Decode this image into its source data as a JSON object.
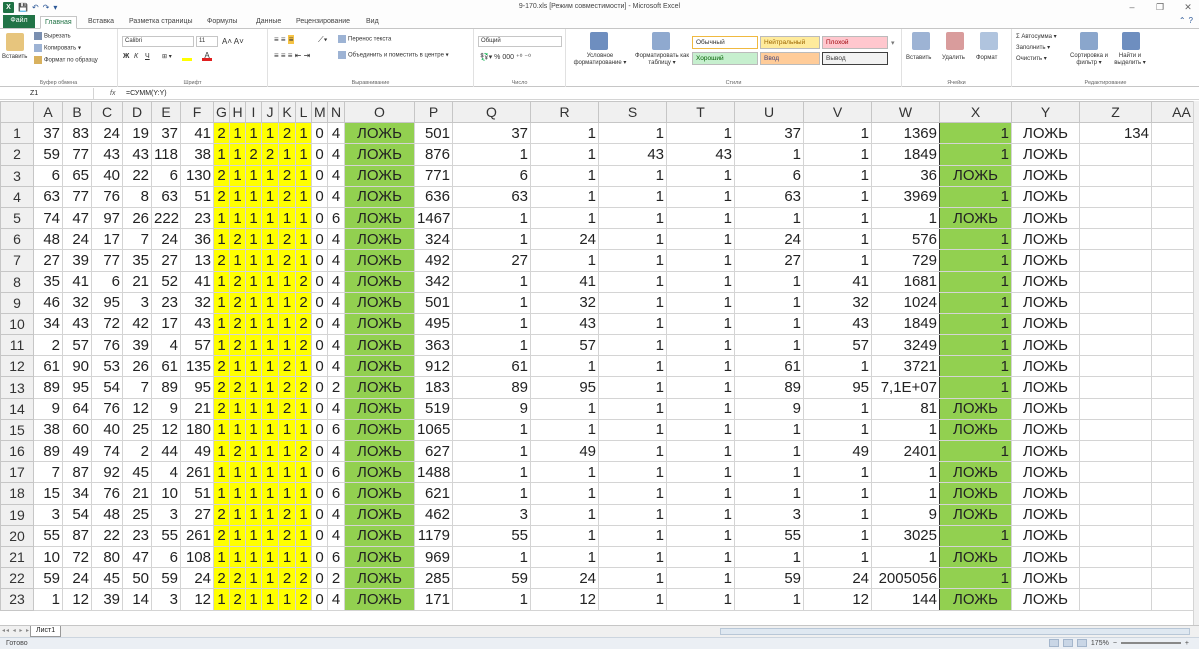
{
  "window": {
    "title": "9-170.xls  [Режим совместимости]  -  Microsoft Excel",
    "minimize": "–",
    "restore": "❐",
    "close": "✕"
  },
  "qat": {
    "save": "💾",
    "undo": "↶",
    "redo": "↷",
    "customize": "▾"
  },
  "tabs": {
    "file": "Файл",
    "home": "Главная",
    "insert": "Вставка",
    "layout": "Разметка страницы",
    "formulas": "Формулы",
    "data": "Данные",
    "review": "Рецензирование",
    "view": "Вид"
  },
  "ribbon": {
    "clipboard": {
      "paste": "Вставить",
      "cut": "Вырезать",
      "copy": "Копировать ▾",
      "format_painter": "Формат по образцу",
      "label": "Буфер обмена"
    },
    "font": {
      "name": "Calibri",
      "size": "11",
      "bold": "Ж",
      "italic": "К",
      "underline": "Ч",
      "label": "Шрифт"
    },
    "alignment": {
      "wrap": "Перенос текста",
      "merge": "Объединить и поместить в центре ▾",
      "label": "Выравнивание"
    },
    "number": {
      "format": "Общий",
      "label": "Число"
    },
    "styles": {
      "conditional": "Условное форматирование ▾",
      "as_table": "Форматировать как таблицу ▾",
      "normal": "Обычный",
      "neutral": "Нейтральный",
      "bad": "Плохой",
      "good": "Хороший",
      "input": "Ввод",
      "output": "Вывод",
      "label": "Стили"
    },
    "cells": {
      "insert": "Вставить",
      "delete": "Удалить",
      "format": "Формат",
      "label": "Ячейки"
    },
    "editing": {
      "autosum": "Σ Автосумма ▾",
      "fill": "Заполнить ▾",
      "clear": "Очистить ▾",
      "sort": "Сортировка и фильтр ▾",
      "find": "Найти и выделить ▾",
      "label": "Редактирование"
    }
  },
  "formula_bar": {
    "name_box": "Z1",
    "fx": "fx",
    "formula": "=СУММ(Y:Y)"
  },
  "columns": [
    "A",
    "B",
    "C",
    "D",
    "E",
    "F",
    "G",
    "H",
    "I",
    "J",
    "K",
    "L",
    "M",
    "N",
    "O",
    "P",
    "Q",
    "R",
    "S",
    "T",
    "U",
    "V",
    "W",
    "X",
    "Y",
    "Z",
    "AA"
  ],
  "rows": [
    [
      "37",
      "83",
      "24",
      "19",
      "37",
      "41",
      "2",
      "1",
      "1",
      "1",
      "2",
      "1",
      "0",
      "4",
      "ЛОЖЬ",
      "501",
      "37",
      "1",
      "1",
      "1",
      "37",
      "1",
      "1369",
      "1",
      "ЛОЖЬ",
      "134"
    ],
    [
      "59",
      "77",
      "43",
      "43",
      "118",
      "38",
      "1",
      "1",
      "2",
      "2",
      "1",
      "1",
      "0",
      "4",
      "ЛОЖЬ",
      "876",
      "1",
      "1",
      "43",
      "43",
      "1",
      "1",
      "1849",
      "1",
      "ЛОЖЬ",
      ""
    ],
    [
      "6",
      "65",
      "40",
      "22",
      "6",
      "130",
      "2",
      "1",
      "1",
      "1",
      "2",
      "1",
      "0",
      "4",
      "ЛОЖЬ",
      "771",
      "6",
      "1",
      "1",
      "1",
      "6",
      "1",
      "36",
      "ЛОЖЬ",
      "ЛОЖЬ",
      ""
    ],
    [
      "63",
      "77",
      "76",
      "8",
      "63",
      "51",
      "2",
      "1",
      "1",
      "1",
      "2",
      "1",
      "0",
      "4",
      "ЛОЖЬ",
      "636",
      "63",
      "1",
      "1",
      "1",
      "63",
      "1",
      "3969",
      "1",
      "ЛОЖЬ",
      ""
    ],
    [
      "74",
      "47",
      "97",
      "26",
      "222",
      "23",
      "1",
      "1",
      "1",
      "1",
      "1",
      "1",
      "0",
      "6",
      "ЛОЖЬ",
      "1467",
      "1",
      "1",
      "1",
      "1",
      "1",
      "1",
      "1",
      "ЛОЖЬ",
      "ЛОЖЬ",
      ""
    ],
    [
      "48",
      "24",
      "17",
      "7",
      "24",
      "36",
      "1",
      "2",
      "1",
      "1",
      "2",
      "1",
      "0",
      "4",
      "ЛОЖЬ",
      "324",
      "1",
      "24",
      "1",
      "1",
      "24",
      "1",
      "576",
      "1",
      "ЛОЖЬ",
      ""
    ],
    [
      "27",
      "39",
      "77",
      "35",
      "27",
      "13",
      "2",
      "1",
      "1",
      "1",
      "2",
      "1",
      "0",
      "4",
      "ЛОЖЬ",
      "492",
      "27",
      "1",
      "1",
      "1",
      "27",
      "1",
      "729",
      "1",
      "ЛОЖЬ",
      ""
    ],
    [
      "35",
      "41",
      "6",
      "21",
      "52",
      "41",
      "1",
      "2",
      "1",
      "1",
      "1",
      "2",
      "0",
      "4",
      "ЛОЖЬ",
      "342",
      "1",
      "41",
      "1",
      "1",
      "1",
      "41",
      "1681",
      "1",
      "ЛОЖЬ",
      ""
    ],
    [
      "46",
      "32",
      "95",
      "3",
      "23",
      "32",
      "1",
      "2",
      "1",
      "1",
      "1",
      "2",
      "0",
      "4",
      "ЛОЖЬ",
      "501",
      "1",
      "32",
      "1",
      "1",
      "1",
      "32",
      "1024",
      "1",
      "ЛОЖЬ",
      ""
    ],
    [
      "34",
      "43",
      "72",
      "42",
      "17",
      "43",
      "1",
      "2",
      "1",
      "1",
      "1",
      "2",
      "0",
      "4",
      "ЛОЖЬ",
      "495",
      "1",
      "43",
      "1",
      "1",
      "1",
      "43",
      "1849",
      "1",
      "ЛОЖЬ",
      ""
    ],
    [
      "2",
      "57",
      "76",
      "39",
      "4",
      "57",
      "1",
      "2",
      "1",
      "1",
      "1",
      "2",
      "0",
      "4",
      "ЛОЖЬ",
      "363",
      "1",
      "57",
      "1",
      "1",
      "1",
      "57",
      "3249",
      "1",
      "ЛОЖЬ",
      ""
    ],
    [
      "61",
      "90",
      "53",
      "26",
      "61",
      "135",
      "2",
      "1",
      "1",
      "1",
      "2",
      "1",
      "0",
      "4",
      "ЛОЖЬ",
      "912",
      "61",
      "1",
      "1",
      "1",
      "61",
      "1",
      "3721",
      "1",
      "ЛОЖЬ",
      ""
    ],
    [
      "89",
      "95",
      "54",
      "7",
      "89",
      "95",
      "2",
      "2",
      "1",
      "1",
      "2",
      "2",
      "0",
      "2",
      "ЛОЖЬ",
      "183",
      "89",
      "95",
      "1",
      "1",
      "89",
      "95",
      "7,1E+07",
      "1",
      "ЛОЖЬ",
      ""
    ],
    [
      "9",
      "64",
      "76",
      "12",
      "9",
      "21",
      "2",
      "1",
      "1",
      "1",
      "2",
      "1",
      "0",
      "4",
      "ЛОЖЬ",
      "519",
      "9",
      "1",
      "1",
      "1",
      "9",
      "1",
      "81",
      "ЛОЖЬ",
      "ЛОЖЬ",
      ""
    ],
    [
      "38",
      "60",
      "40",
      "25",
      "12",
      "180",
      "1",
      "1",
      "1",
      "1",
      "1",
      "1",
      "0",
      "6",
      "ЛОЖЬ",
      "1065",
      "1",
      "1",
      "1",
      "1",
      "1",
      "1",
      "1",
      "ЛОЖЬ",
      "ЛОЖЬ",
      ""
    ],
    [
      "89",
      "49",
      "74",
      "2",
      "44",
      "49",
      "1",
      "2",
      "1",
      "1",
      "1",
      "2",
      "0",
      "4",
      "ЛОЖЬ",
      "627",
      "1",
      "49",
      "1",
      "1",
      "1",
      "49",
      "2401",
      "1",
      "ЛОЖЬ",
      ""
    ],
    [
      "7",
      "87",
      "92",
      "45",
      "4",
      "261",
      "1",
      "1",
      "1",
      "1",
      "1",
      "1",
      "0",
      "6",
      "ЛОЖЬ",
      "1488",
      "1",
      "1",
      "1",
      "1",
      "1",
      "1",
      "1",
      "ЛОЖЬ",
      "ЛОЖЬ",
      ""
    ],
    [
      "15",
      "34",
      "76",
      "21",
      "10",
      "51",
      "1",
      "1",
      "1",
      "1",
      "1",
      "1",
      "0",
      "6",
      "ЛОЖЬ",
      "621",
      "1",
      "1",
      "1",
      "1",
      "1",
      "1",
      "1",
      "ЛОЖЬ",
      "ЛОЖЬ",
      ""
    ],
    [
      "3",
      "54",
      "48",
      "25",
      "3",
      "27",
      "2",
      "1",
      "1",
      "1",
      "2",
      "1",
      "0",
      "4",
      "ЛОЖЬ",
      "462",
      "3",
      "1",
      "1",
      "1",
      "3",
      "1",
      "9",
      "ЛОЖЬ",
      "ЛОЖЬ",
      ""
    ],
    [
      "55",
      "87",
      "22",
      "23",
      "55",
      "261",
      "2",
      "1",
      "1",
      "1",
      "2",
      "1",
      "0",
      "4",
      "ЛОЖЬ",
      "1179",
      "55",
      "1",
      "1",
      "1",
      "55",
      "1",
      "3025",
      "1",
      "ЛОЖЬ",
      ""
    ],
    [
      "10",
      "72",
      "80",
      "47",
      "6",
      "108",
      "1",
      "1",
      "1",
      "1",
      "1",
      "1",
      "0",
      "6",
      "ЛОЖЬ",
      "969",
      "1",
      "1",
      "1",
      "1",
      "1",
      "1",
      "1",
      "ЛОЖЬ",
      "ЛОЖЬ",
      ""
    ],
    [
      "59",
      "24",
      "45",
      "50",
      "59",
      "24",
      "2",
      "2",
      "1",
      "1",
      "2",
      "2",
      "0",
      "2",
      "ЛОЖЬ",
      "285",
      "59",
      "24",
      "1",
      "1",
      "59",
      "24",
      "2005056",
      "1",
      "ЛОЖЬ",
      ""
    ],
    [
      "1",
      "12",
      "39",
      "14",
      "3",
      "12",
      "1",
      "2",
      "1",
      "1",
      "1",
      "2",
      "0",
      "4",
      "ЛОЖЬ",
      "171",
      "1",
      "12",
      "1",
      "1",
      "1",
      "12",
      "144",
      "ЛОЖЬ",
      "ЛОЖЬ",
      ""
    ]
  ],
  "sheet_tabs": {
    "nav": "◂◂ ◂ ▸ ▸▸",
    "active": "Лист1"
  },
  "status": {
    "ready": "Готово",
    "zoom": "175%",
    "zoom_minus": "−",
    "zoom_plus": "+"
  },
  "colors": {
    "yellow": "#ffff00",
    "green": "#92d050",
    "file_tab": "#217346"
  }
}
